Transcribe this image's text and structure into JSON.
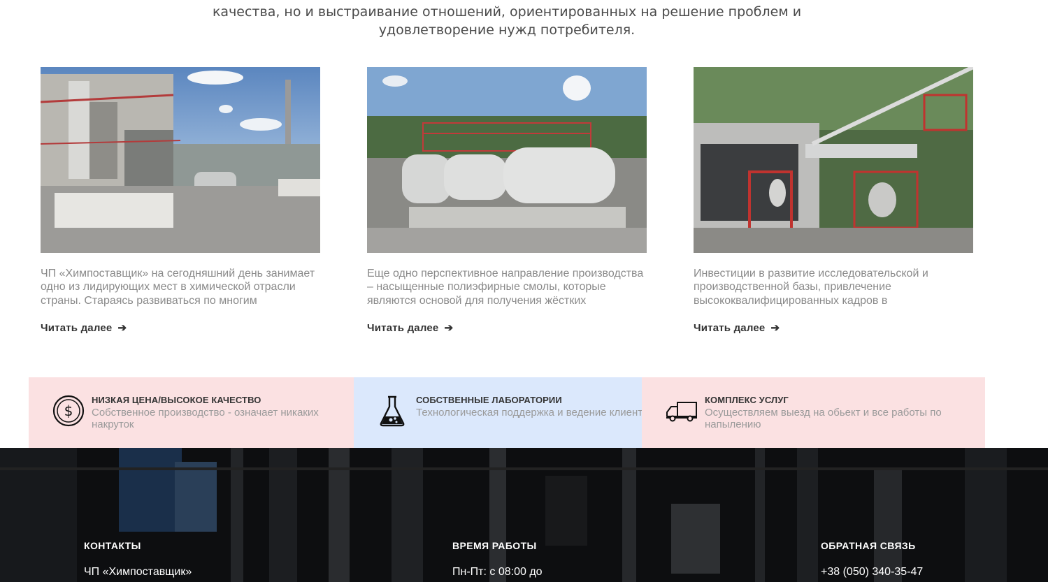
{
  "intro": {
    "line1": "качества, но и выстраивание отношений, ориентированных на решение проблем и",
    "line2": "удовлетворение нужд потребителя."
  },
  "cards": [
    {
      "text": "ЧП «Химпоставщик» на сегодняшний день занимает одно из лидирующих мест в химической отрасли страны. Стараясь развиваться по многим",
      "more_label": "Читать далее"
    },
    {
      "text": "Еще одно перспективное направление производства – насыщенные полиэфирные смолы, которые являются основой для получения жёстких",
      "more_label": "Читать далее"
    },
    {
      "text": "Инвестиции в развитие исследовательской и производственной базы, привлечение высококвалифицированных кадров в",
      "more_label": "Читать далее"
    }
  ],
  "features": [
    {
      "icon": "dollar-coin-icon",
      "title": "НИЗКАЯ ЦЕНА/ВЫСОКОЕ КАЧЕСТВО",
      "desc": "Собственное производство - означает никаких накруток",
      "bg": "#fbe1e2"
    },
    {
      "icon": "lab-flask-icon",
      "title": "СОБСТВЕННЫЕ ЛАБОРАТОРИИ",
      "desc": "Технологическая поддержка и ведение клиента",
      "bg": "#dbe8fc"
    },
    {
      "icon": "delivery-truck-icon",
      "title": "КОМПЛЕКС УСЛУГ",
      "desc": "Осуществляем выезд на обьект и все работы по напылению",
      "bg": "#fbe1e2"
    }
  ],
  "footer": {
    "contacts_title": "КОНТАКТЫ",
    "contacts_value": "ЧП «Химпоставщик»",
    "hours_title": "ВРЕМЯ РАБОТЫ",
    "hours_value": "Пн-Пт: с 08:00 до",
    "feedback_title": "ОБРАТНАЯ СВЯЗЬ",
    "feedback_value": "+38 (050) 340-35-47"
  }
}
